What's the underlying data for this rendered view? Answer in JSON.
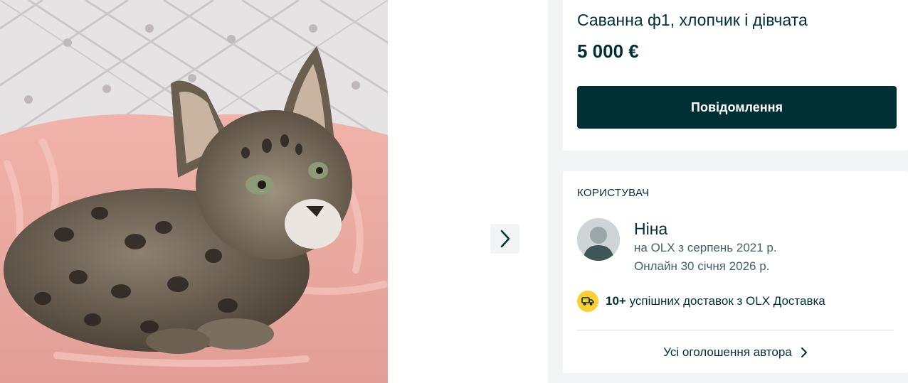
{
  "gallery": {
    "photo_alt": "",
    "next_icon": "chevron-right-icon"
  },
  "ad": {
    "title": "Саванна ф1, хлопчик і дівчата",
    "price": "5 000 €",
    "message_button": "Повідомлення"
  },
  "user": {
    "heading": "КОРИСТУВАЧ",
    "name": "Ніна",
    "member_since": "на OLX з серпень 2021 р.",
    "last_online": "Онлайн 30 січня 2026 р.",
    "delivery_count": "10+",
    "delivery_text": " успішних доставок з OLX Доставка",
    "delivery_icon": "truck-icon",
    "all_ads_link": "Усі оголошення автора",
    "all_ads_icon": "chevron-right-icon",
    "avatar_icon": "user-avatar-icon"
  },
  "colors": {
    "primary": "#002f34",
    "secondary_text": "#406367",
    "panel_bg": "#f2f4f5",
    "delivery_badge": "#ffce32"
  }
}
